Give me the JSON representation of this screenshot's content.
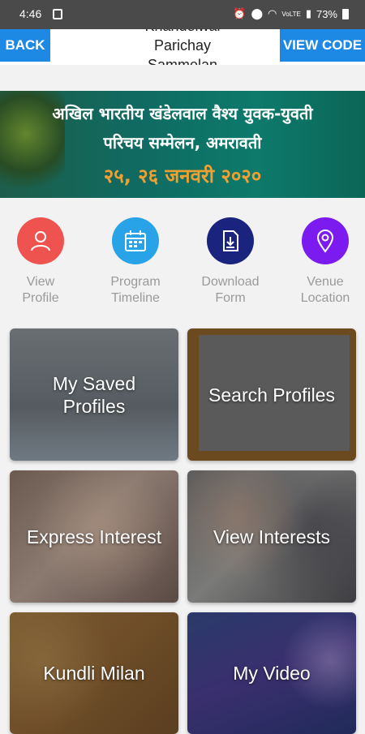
{
  "status": {
    "time": "4:46",
    "battery": "73%",
    "network": "VoLTE"
  },
  "app_bar": {
    "back_label": "BACK",
    "title": "Khandelwal Parichay Sammelan",
    "view_code_label": "VIEW CODE"
  },
  "banner": {
    "line1": "अखिल भारतीय खंडेलवाल वैश्य युवक-युवती",
    "line2": "परिचय सम्मेलन, अमरावती",
    "line3": "२५, २६ जनवरी २०२०"
  },
  "quick_actions": [
    {
      "label": "View Profile",
      "icon": "user-icon",
      "color": "#ef5350"
    },
    {
      "label": "Program Timeline",
      "icon": "calendar-icon",
      "color": "#29a3e8"
    },
    {
      "label": "Download Form",
      "icon": "download-file-icon",
      "color": "#1a237e"
    },
    {
      "label": "Venue Location",
      "icon": "location-pin-icon",
      "color": "#7c1bf0"
    }
  ],
  "tiles": [
    {
      "label": "My Saved Profiles"
    },
    {
      "label": "Search Profiles"
    },
    {
      "label": "Express Interest"
    },
    {
      "label": "View Interests"
    },
    {
      "label": "Kundli Milan"
    },
    {
      "label": "My Video"
    }
  ]
}
